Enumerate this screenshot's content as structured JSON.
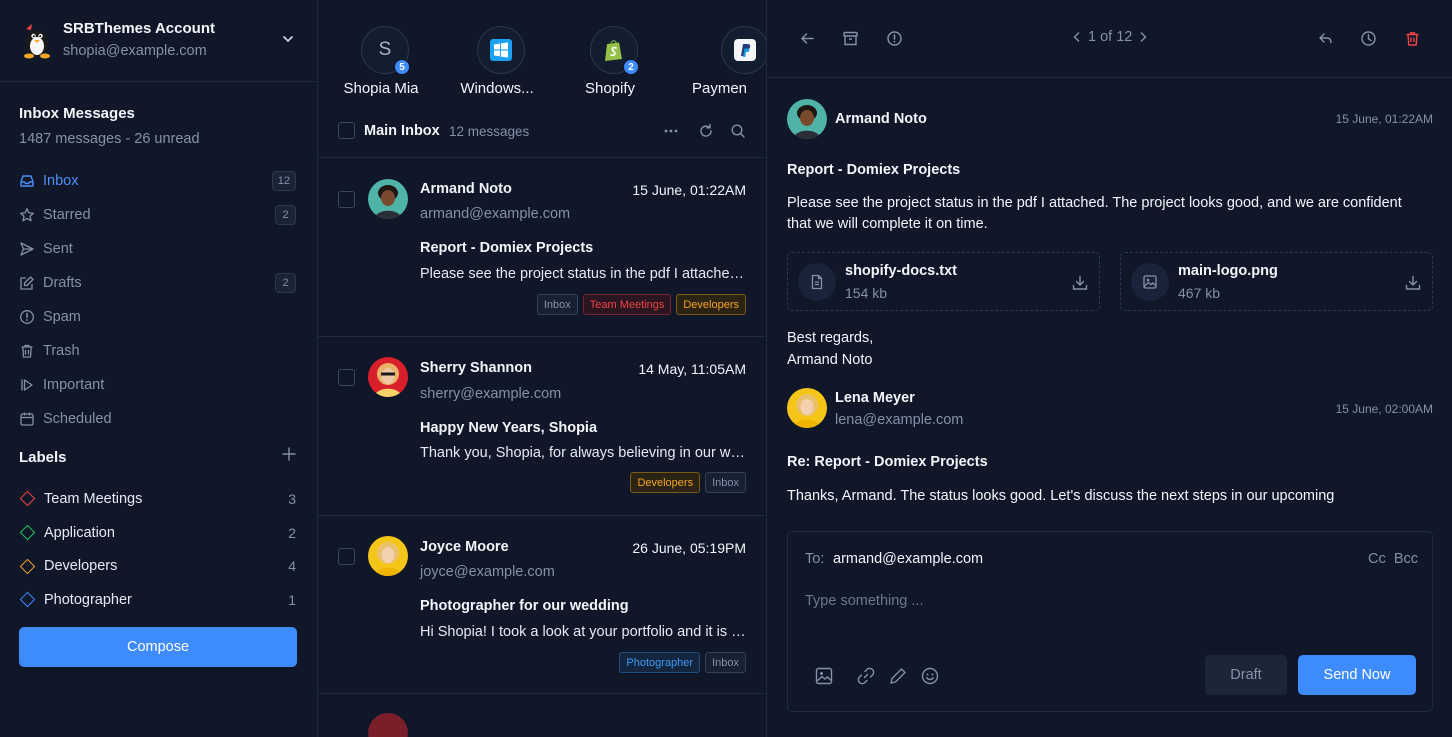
{
  "account": {
    "name": "SRBThemes Account",
    "email": "shopia@example.com"
  },
  "mailbox": {
    "title": "Inbox Messages",
    "summary": "1487 messages - 26 unread"
  },
  "nav": [
    {
      "label": "Inbox",
      "count": "12"
    },
    {
      "label": "Starred",
      "count": "2"
    },
    {
      "label": "Sent",
      "count": ""
    },
    {
      "label": "Drafts",
      "count": "2"
    },
    {
      "label": "Spam",
      "count": ""
    },
    {
      "label": "Trash",
      "count": ""
    },
    {
      "label": "Important",
      "count": ""
    },
    {
      "label": "Scheduled",
      "count": ""
    }
  ],
  "labels": {
    "title": "Labels",
    "items": [
      {
        "label": "Team Meetings",
        "count": "3",
        "color": "#ef4444"
      },
      {
        "label": "Application",
        "count": "2",
        "color": "#22c55e"
      },
      {
        "label": "Developers",
        "count": "4",
        "color": "#f5a524"
      },
      {
        "label": "Photographer",
        "count": "1",
        "color": "#3d8bfd"
      }
    ]
  },
  "compose_label": "Compose",
  "stories": [
    {
      "name": "Shopia Mia",
      "initial": "S",
      "badge": "5",
      "icon": "initial"
    },
    {
      "name": "Windows...",
      "initial": "",
      "badge": "",
      "icon": "windows-icon"
    },
    {
      "name": "Shopify",
      "initial": "",
      "badge": "2",
      "icon": "shopify-icon"
    },
    {
      "name": "Paymen",
      "initial": "",
      "badge": "",
      "icon": "paypal-icon"
    }
  ],
  "list": {
    "title": "Main Inbox",
    "count": "12 messages",
    "mails": [
      {
        "from": "Armand Noto",
        "date": "15 June, 01:22AM",
        "email": "armand@example.com",
        "subject": "Report - Domiex Projects",
        "preview": "Please see the project status in the pdf I attached. The project looks good",
        "tags": [
          "Inbox",
          "Team Meetings",
          "Developers"
        ]
      },
      {
        "from": "Sherry Shannon",
        "date": "14 May, 11:05AM",
        "email": "sherry@example.com",
        "subject": "Happy New Years, Shopia",
        "preview": "Thank you, Shopia, for always believing in our work",
        "tags": [
          "Developers",
          "Inbox"
        ]
      },
      {
        "from": "Joyce Moore",
        "date": "26 June, 05:19PM",
        "email": "joyce@example.com",
        "subject": "Photographer for our wedding",
        "preview": "Hi Shopia! I took a look at your portfolio and it is amazing",
        "tags": [
          "Photographer",
          "Inbox"
        ]
      }
    ]
  },
  "reader": {
    "pager": "1 of 12",
    "message": {
      "from": "Armand Noto",
      "time": "15 June, 01:22AM",
      "subject": "Report - Domiex Projects",
      "body": "Please see the project status in the pdf I attached. The project looks good, and we are confident that we will complete it on time.",
      "attachments": [
        {
          "name": "shopify-docs.txt",
          "size": "154 kb",
          "icon": "file-icon"
        },
        {
          "name": "main-logo.png",
          "size": "467 kb",
          "icon": "image-icon"
        }
      ],
      "signoff": "Best regards,",
      "signature": "Armand Noto"
    },
    "reply_message": {
      "from": "Lena Meyer",
      "email": "lena@example.com",
      "time": "15 June, 02:00AM",
      "subject": "Re: Report - Domiex Projects",
      "body": "Thanks, Armand. The status looks good. Let's discuss the next steps in our upcoming"
    },
    "composer": {
      "to_label": "To:",
      "to_value": "armand@example.com",
      "cc_label": "Cc",
      "bcc_label": "Bcc",
      "placeholder": "Type something ...",
      "draft_label": "Draft",
      "send_label": "Send Now"
    }
  }
}
